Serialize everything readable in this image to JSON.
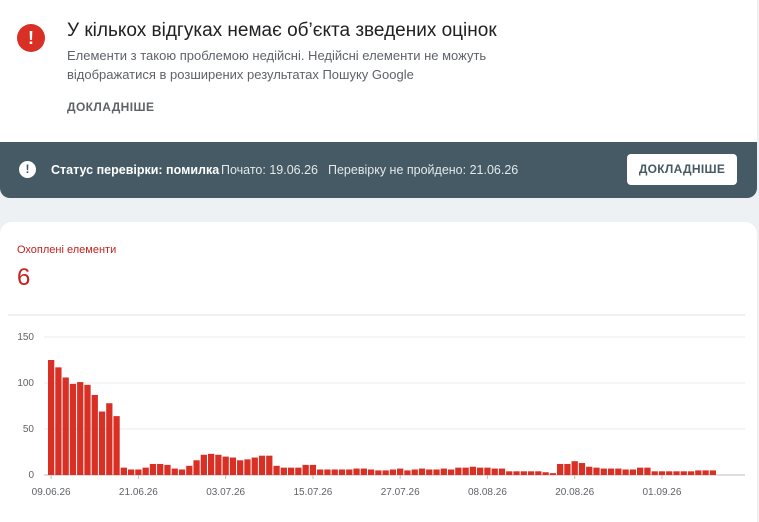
{
  "issue": {
    "title": "У кількох відгуках немає об’єкта зведених оцінок",
    "description": "Елементи з такою проблемою недійсні. Недійсні елементи не можуть відображатися в розширених результатах Пошуку Google",
    "learn_more": "ДОКЛАДНІШЕ",
    "icon": "error-icon"
  },
  "status": {
    "label": "Статус перевірки: помилка",
    "started": "Почато: 19.06.26",
    "failed": "Перевірку не пройдено: 21.06.26",
    "button": "ДОКЛАДНІШЕ"
  },
  "metric": {
    "label": "Охоплені елементи",
    "value": "6",
    "color": "#c5221f"
  },
  "chart_data": {
    "type": "bar",
    "color": "#d93025",
    "ylim": [
      0,
      150
    ],
    "yticks": [
      0,
      50,
      100,
      150
    ],
    "xtick_labels": [
      "09.06.26",
      "21.06.26",
      "03.07.26",
      "15.07.26",
      "27.07.26",
      "08.08.26",
      "20.08.26",
      "01.09.26"
    ],
    "xtick_index": [
      0,
      12,
      24,
      36,
      48,
      60,
      72,
      84
    ],
    "values": [
      125,
      117,
      106,
      99,
      101,
      98,
      87,
      69,
      78,
      64,
      8,
      6,
      6,
      8,
      12,
      12,
      11,
      7,
      6,
      10,
      16,
      22,
      23,
      22,
      20,
      19,
      16,
      17,
      19,
      21,
      21,
      10,
      8,
      8,
      8,
      11,
      11,
      6,
      6,
      6,
      6,
      6,
      7,
      7,
      6,
      5,
      5,
      6,
      7,
      5,
      6,
      7,
      6,
      6,
      7,
      6,
      8,
      8,
      9,
      8,
      8,
      7,
      7,
      4,
      4,
      4,
      4,
      4,
      3,
      2,
      12,
      12,
      15,
      13,
      9,
      8,
      7,
      7,
      7,
      6,
      6,
      8,
      8,
      4,
      4,
      4,
      4,
      4,
      4,
      5,
      5,
      5
    ]
  }
}
